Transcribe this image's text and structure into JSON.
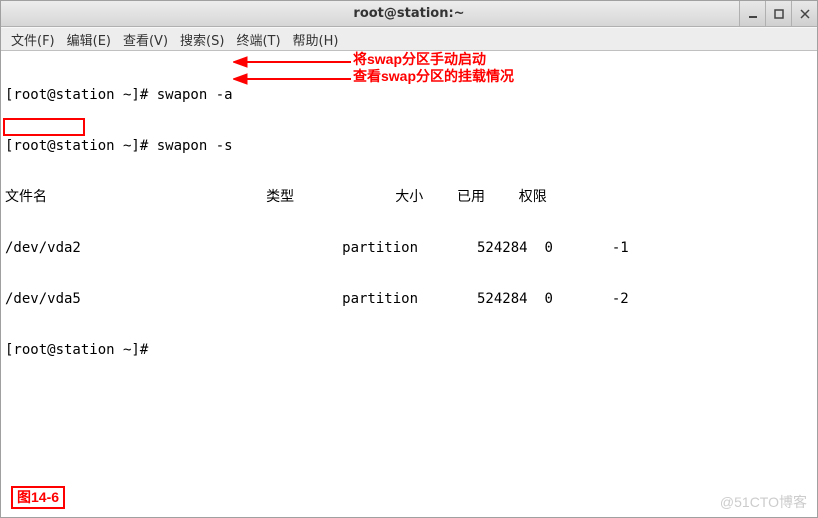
{
  "titlebar": {
    "title": "root@station:~"
  },
  "menu": {
    "file": "文件(F)",
    "edit": "编辑(E)",
    "view": "查看(V)",
    "search": "搜索(S)",
    "terminal": "终端(T)",
    "help": "帮助(H)"
  },
  "terminal": {
    "lines": {
      "l0": "[root@station ~]# swapon -a",
      "l1": "[root@station ~]# swapon -s",
      "l2": "文件名                          类型            大小    已用    权限",
      "l3": "/dev/vda2                               partition       524284  0       -1",
      "l4": "/dev/vda5                               partition       524284  0       -2",
      "l5": "[root@station ~]# "
    }
  },
  "annotations": {
    "a1": "将swap分区手动启动",
    "a2": "查看swap分区的挂载情况"
  },
  "figure_label": "图14-6",
  "watermark": "@51CTO博客"
}
